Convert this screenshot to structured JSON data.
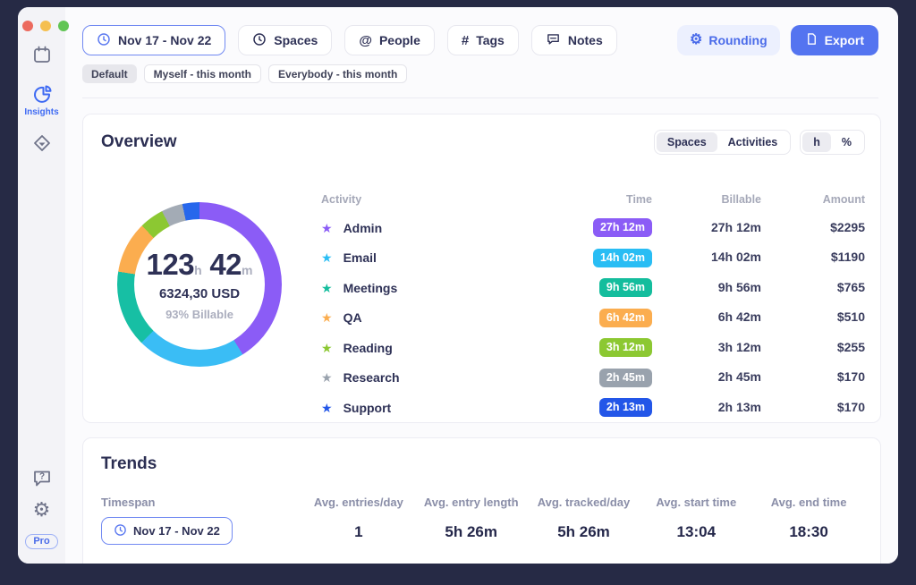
{
  "window": {
    "traffic_lights": [
      "close",
      "minimize",
      "zoom"
    ]
  },
  "sidebar": {
    "items": [
      {
        "name": "calendar"
      },
      {
        "name": "insights",
        "label": "Insights",
        "active": true
      },
      {
        "name": "automation"
      },
      {
        "name": "help"
      },
      {
        "name": "settings"
      }
    ],
    "insights_label": "Insights",
    "pro_badge": "Pro"
  },
  "toolbar": {
    "date_range": "Nov 17 - Nov 22",
    "filter_buttons": [
      {
        "label": "Spaces",
        "icon": "clock-icon"
      },
      {
        "label": "People",
        "icon": "at-icon"
      },
      {
        "label": "Tags",
        "icon": "hash-icon"
      },
      {
        "label": "Notes",
        "icon": "note-bubble-icon"
      }
    ],
    "rounding_label": "Rounding",
    "export_label": "Export"
  },
  "filters": {
    "chips": [
      {
        "label": "Default",
        "active": true
      },
      {
        "label": "Myself - this month",
        "active": false
      },
      {
        "label": "Everybody - this month",
        "active": false
      }
    ]
  },
  "overview": {
    "title": "Overview",
    "view_toggle": {
      "options": [
        "Spaces",
        "Activities"
      ],
      "selected": "Spaces"
    },
    "unit_toggle": {
      "options": [
        "h",
        "%"
      ],
      "selected": "h"
    },
    "donut": {
      "hours": "123",
      "hours_unit": "h",
      "minutes": "42",
      "minutes_unit": "m",
      "usd": "6324,30 USD",
      "billable": "93% Billable"
    },
    "table": {
      "headers": [
        "Activity",
        "Time",
        "Billable",
        "Amount"
      ],
      "rows": [
        {
          "name": "Admin",
          "time": "27h 12m",
          "billable": "27h 12m",
          "amount": "$2295",
          "color": "#8B5CF6"
        },
        {
          "name": "Email",
          "time": "14h 02m",
          "billable": "14h 02m",
          "amount": "$1190",
          "color": "#29BDF4"
        },
        {
          "name": "Meetings",
          "time": "9h 56m",
          "billable": "9h 56m",
          "amount": "$765",
          "color": "#14BD9D"
        },
        {
          "name": "QA",
          "time": "6h 42m",
          "billable": "6h 42m",
          "amount": "$510",
          "color": "#FBAD4F"
        },
        {
          "name": "Reading",
          "time": "3h 12m",
          "billable": "3h 12m",
          "amount": "$255",
          "color": "#8CC832"
        },
        {
          "name": "Research",
          "time": "2h 45m",
          "billable": "2h 45m",
          "amount": "$170",
          "color": "#99A2AD"
        },
        {
          "name": "Support",
          "time": "2h 13m",
          "billable": "2h 13m",
          "amount": "$170",
          "color": "#2356E8"
        }
      ]
    }
  },
  "trends": {
    "title": "Trends",
    "timespan_label": "Timespan",
    "timespan_value": "Nov 17 - Nov 22",
    "stats": [
      {
        "label": "Avg. entries/day",
        "value": "1"
      },
      {
        "label": "Avg. entry length",
        "value": "5h 26m"
      },
      {
        "label": "Avg. tracked/day",
        "value": "5h 26m"
      },
      {
        "label": "Avg. start time",
        "value": "13:04"
      },
      {
        "label": "Avg. end time",
        "value": "18:30"
      }
    ]
  },
  "chart_data": {
    "type": "pie",
    "title": "Tracked time by activity",
    "center_labels": [
      "123h 42m",
      "6324,30 USD",
      "93% Billable"
    ],
    "segments": [
      {
        "name": "Admin",
        "minutes": 1632,
        "color": "#8B5CF6"
      },
      {
        "name": "Email",
        "minutes": 842,
        "color": "#3ABDF5"
      },
      {
        "name": "Meetings",
        "minutes": 596,
        "color": "#17BFA4"
      },
      {
        "name": "QA",
        "minutes": 402,
        "color": "#FBAD4F"
      },
      {
        "name": "Reading",
        "minutes": 192,
        "color": "#8CC832"
      },
      {
        "name": "Research",
        "minutes": 165,
        "color": "#A3ABB5"
      },
      {
        "name": "Support",
        "minutes": 133,
        "color": "#2767EC"
      }
    ]
  },
  "colors": {
    "accent_blue": "#5474F0",
    "background_dark": "#262A45"
  }
}
